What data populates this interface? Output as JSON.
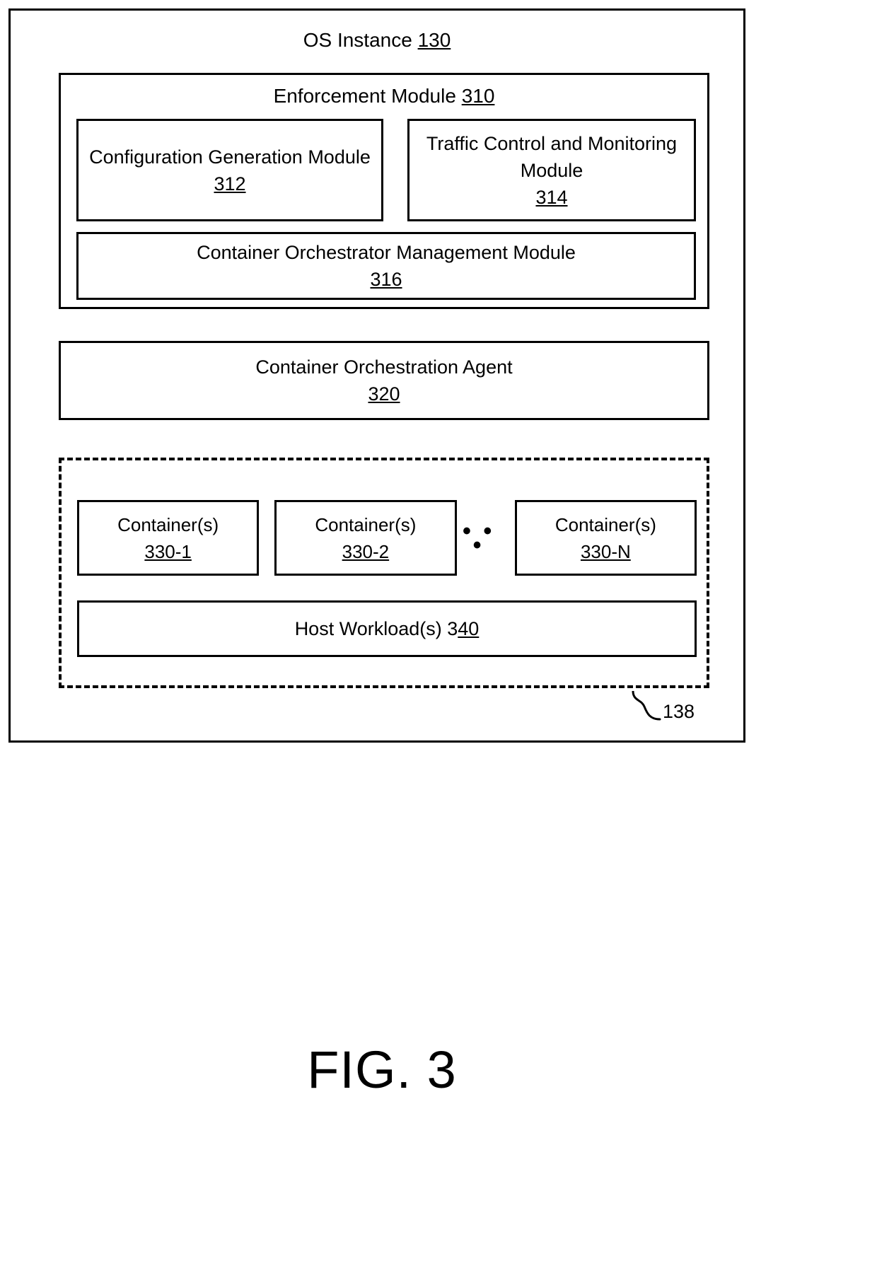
{
  "figure": {
    "caption": "FIG. 3",
    "outer": {
      "title_text": "OS Instance ",
      "title_ref": "130"
    },
    "callout": {
      "label": "138",
      "leader": "curly-brace-leader"
    }
  },
  "enforcement_module": {
    "title_text": "Enforcement Module ",
    "title_ref": "310",
    "submodules": [
      {
        "name": "configuration-generation-module",
        "label": "Configuration Generation Module",
        "ref": "312"
      },
      {
        "name": "traffic-control-and-monitoring-module",
        "label": "Traffic Control and Monitoring Module",
        "ref": "314"
      },
      {
        "name": "container-orchestrator-management-module",
        "label": "Container Orchestrator Management Module",
        "ref": "316"
      }
    ]
  },
  "orchestration_agent": {
    "label": "Container Orchestration Agent",
    "ref": "320"
  },
  "workload_region": {
    "border_style": "dashed",
    "containers": [
      {
        "label": "Container(s)",
        "ref": "330-1"
      },
      {
        "label": "Container(s)",
        "ref": "330-2"
      },
      {
        "label": "Container(s)",
        "ref": "330-N"
      }
    ],
    "ellipsis": "• • •",
    "host_workload": {
      "label_pre": "Host Workload(s) 3",
      "label_ref": "40"
    }
  },
  "colors": {
    "stroke": "#000000",
    "background": "#ffffff"
  }
}
